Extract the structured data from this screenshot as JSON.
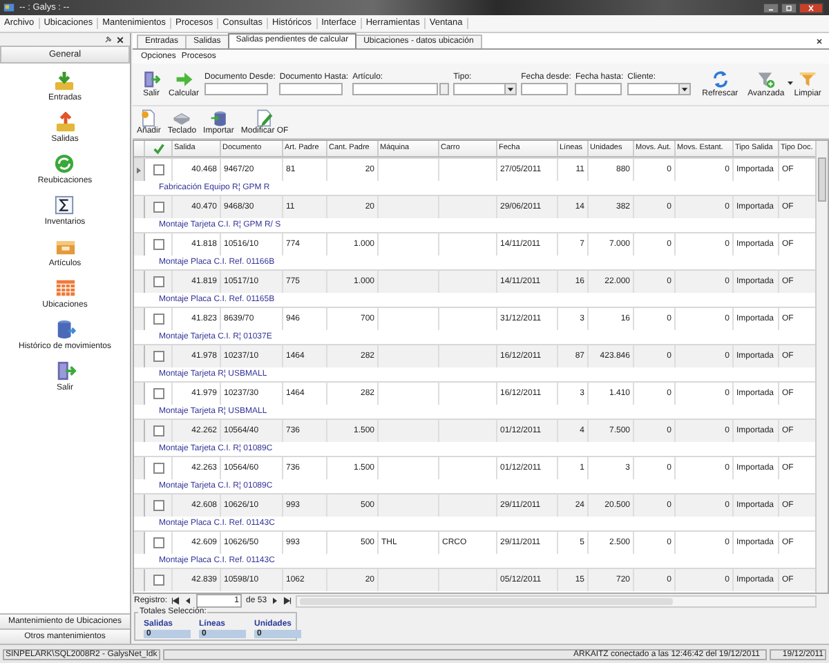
{
  "window": {
    "title": "-- : Galys : --"
  },
  "menu": [
    "Archivo",
    "Ubicaciones",
    "Mantenimientos",
    "Procesos",
    "Consultas",
    "Históricos",
    "Interface",
    "Herramientas",
    "Ventana"
  ],
  "sidebar": {
    "header": "General",
    "items": [
      {
        "label": "Entradas",
        "kind": "in"
      },
      {
        "label": "Salidas",
        "kind": "out"
      },
      {
        "label": "Reubicaciones",
        "kind": "relocate"
      },
      {
        "label": "Inventarios",
        "kind": "sum"
      },
      {
        "label": "Artículos",
        "kind": "box"
      },
      {
        "label": "Ubicaciones",
        "kind": "grid"
      },
      {
        "label": "Histórico de movimientos",
        "kind": "history"
      },
      {
        "label": "Salir",
        "kind": "exit"
      }
    ],
    "footer_buttons": [
      "Mantenimiento de Ubicaciones",
      "Otros mantenimientos"
    ]
  },
  "tabs": [
    {
      "label": "Entradas",
      "selected": false
    },
    {
      "label": "Salidas",
      "selected": false
    },
    {
      "label": "Salidas pendientes de calcular",
      "selected": true
    },
    {
      "label": "Ubicaciones - datos ubicación",
      "selected": false
    }
  ],
  "submenu": [
    "Opciones",
    "Procesos"
  ],
  "toolbar": [
    {
      "label": "Salir",
      "kind": "exit"
    },
    {
      "label": "Calcular",
      "kind": "arrow"
    }
  ],
  "filters": [
    {
      "label": "Documento Desde:",
      "kind": "text"
    },
    {
      "label": "Documento Hasta:",
      "kind": "text"
    },
    {
      "label": "Artículo:",
      "kind": "lookup"
    },
    {
      "label": "Tipo:",
      "kind": "combo"
    },
    {
      "label": "Fecha desde:",
      "kind": "date"
    },
    {
      "label": "Fecha hasta:",
      "kind": "date"
    },
    {
      "label": "Cliente:",
      "kind": "combo"
    }
  ],
  "filter_buttons": [
    {
      "label": "Refrescar",
      "kind": "refresh"
    },
    {
      "label": "Avanzada",
      "kind": "filter-advanced"
    },
    {
      "label": "Limpiar",
      "kind": "filter-clear"
    }
  ],
  "actions": [
    {
      "label": "Añadir",
      "kind": "add"
    },
    {
      "label": "Teclado",
      "kind": "keyboard"
    },
    {
      "label": "Importar",
      "kind": "import"
    },
    {
      "label": "Modificar OF",
      "kind": "edit"
    }
  ],
  "table": {
    "columns": [
      "Salida",
      "Documento",
      "Art. Padre",
      "Cant. Padre",
      "Máquina",
      "Carro",
      "Fecha",
      "Líneas",
      "Unidades",
      "Movs. Aut.",
      "Movs. Estant.",
      "Tipo Salida",
      "Tipo Doc."
    ],
    "rows": [
      {
        "current": true,
        "checked": false,
        "salida": "40.468",
        "documento": "9467/20",
        "art_padre": "81",
        "cant_padre": "20",
        "fecha": "27/05/2011",
        "lineas": "11",
        "unidades": "880",
        "movs_aut": "0",
        "movs_estant": "0",
        "tipo_salida": "Importada",
        "tipo_doc": "OF",
        "description": "Fabricación Equipo R¦ GPM R"
      },
      {
        "current": false,
        "checked": false,
        "salida": "40.470",
        "documento": "9468/30",
        "art_padre": "11",
        "cant_padre": "20",
        "fecha": "29/06/2011",
        "lineas": "14",
        "unidades": "382",
        "movs_aut": "0",
        "movs_estant": "0",
        "tipo_salida": "Importada",
        "tipo_doc": "OF",
        "description": "Montaje Tarjeta C.I. R¦ GPM R/ S"
      },
      {
        "current": false,
        "checked": false,
        "salida": "41.818",
        "documento": "10516/10",
        "art_padre": "774",
        "cant_padre": "1.000",
        "fecha": "14/11/2011",
        "lineas": "7",
        "unidades": "7.000",
        "movs_aut": "0",
        "movs_estant": "0",
        "tipo_salida": "Importada",
        "tipo_doc": "OF",
        "description": "Montaje Placa C.I. Ref. 01166B"
      },
      {
        "current": false,
        "checked": false,
        "salida": "41.819",
        "documento": "10517/10",
        "art_padre": "775",
        "cant_padre": "1.000",
        "fecha": "14/11/2011",
        "lineas": "16",
        "unidades": "22.000",
        "movs_aut": "0",
        "movs_estant": "0",
        "tipo_salida": "Importada",
        "tipo_doc": "OF",
        "description": "Montaje Placa C.I. Ref. 01165B"
      },
      {
        "current": false,
        "checked": false,
        "salida": "41.823",
        "documento": "8639/70",
        "art_padre": "946",
        "cant_padre": "700",
        "fecha": "31/12/2011",
        "lineas": "3",
        "unidades": "16",
        "movs_aut": "0",
        "movs_estant": "0",
        "tipo_salida": "Importada",
        "tipo_doc": "OF",
        "description": "Montaje Tarjeta C.I. R¦ 01037E"
      },
      {
        "current": false,
        "checked": false,
        "salida": "41.978",
        "documento": "10237/10",
        "art_padre": "1464",
        "cant_padre": "282",
        "fecha": "16/12/2011",
        "lineas": "87",
        "unidades": "423.846",
        "movs_aut": "0",
        "movs_estant": "0",
        "tipo_salida": "Importada",
        "tipo_doc": "OF",
        "description": "Montaje Tarjeta R¦ USBMALL"
      },
      {
        "current": false,
        "checked": false,
        "salida": "41.979",
        "documento": "10237/30",
        "art_padre": "1464",
        "cant_padre": "282",
        "fecha": "16/12/2011",
        "lineas": "3",
        "unidades": "1.410",
        "movs_aut": "0",
        "movs_estant": "0",
        "tipo_salida": "Importada",
        "tipo_doc": "OF",
        "description": "Montaje Tarjeta R¦ USBMALL"
      },
      {
        "current": false,
        "checked": false,
        "salida": "42.262",
        "documento": "10564/40",
        "art_padre": "736",
        "cant_padre": "1.500",
        "fecha": "01/12/2011",
        "lineas": "4",
        "unidades": "7.500",
        "movs_aut": "0",
        "movs_estant": "0",
        "tipo_salida": "Importada",
        "tipo_doc": "OF",
        "description": "Montaje Tarjeta C.I. R¦ 01089C"
      },
      {
        "current": false,
        "checked": false,
        "salida": "42.263",
        "documento": "10564/60",
        "art_padre": "736",
        "cant_padre": "1.500",
        "fecha": "01/12/2011",
        "lineas": "1",
        "unidades": "3",
        "movs_aut": "0",
        "movs_estant": "0",
        "tipo_salida": "Importada",
        "tipo_doc": "OF",
        "description": "Montaje Tarjeta C.I. R¦ 01089C"
      },
      {
        "current": false,
        "checked": false,
        "salida": "42.608",
        "documento": "10626/10",
        "art_padre": "993",
        "cant_padre": "500",
        "fecha": "29/11/2011",
        "lineas": "24",
        "unidades": "20.500",
        "movs_aut": "0",
        "movs_estant": "0",
        "tipo_salida": "Importada",
        "tipo_doc": "OF",
        "description": "Montaje Placa C.I. Ref. 01143C"
      },
      {
        "current": false,
        "checked": false,
        "salida": "42.609",
        "documento": "10626/50",
        "art_padre": "993",
        "cant_padre": "500",
        "maquina": "THL",
        "carro": "CRCO",
        "fecha": "29/11/2011",
        "lineas": "5",
        "unidades": "2.500",
        "movs_aut": "0",
        "movs_estant": "0",
        "tipo_salida": "Importada",
        "tipo_doc": "OF",
        "description": "Montaje Placa C.I. Ref. 01143C"
      },
      {
        "current": false,
        "checked": false,
        "salida": "42.839",
        "documento": "10598/10",
        "art_padre": "1062",
        "cant_padre": "20",
        "fecha": "05/12/2011",
        "lineas": "15",
        "unidades": "720",
        "movs_aut": "0",
        "movs_estant": "0",
        "tipo_salida": "Importada",
        "tipo_doc": "OF"
      }
    ]
  },
  "pager": {
    "label": "Registro:",
    "value": "1",
    "total": "de 53"
  },
  "totals": {
    "title": "Totales Selección:",
    "items": [
      {
        "label": "Salidas",
        "value": "0"
      },
      {
        "label": "Líneas",
        "value": "0"
      },
      {
        "label": "Unidades",
        "value": "0"
      }
    ]
  },
  "status_bar": {
    "connection": "SINPELARK\\SQL2008R2 - GalysNet_Idk",
    "user": "ARKAITZ conectado a las 12:46:42 del 19/12/2011",
    "date": "19/12/2011"
  }
}
